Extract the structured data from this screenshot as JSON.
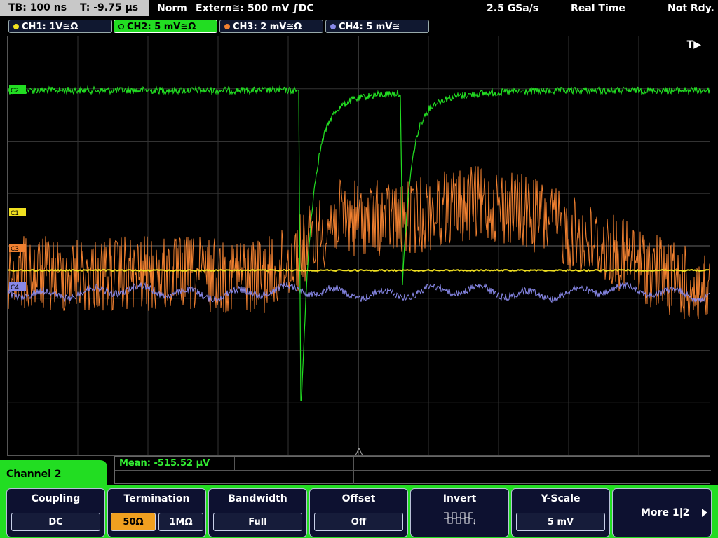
{
  "status": {
    "timebase": "TB: 100 ns",
    "trigger_time": "T: -9.75 μs",
    "mode": "Norm",
    "trigger": "Extern≅: 500 mV ∫DC",
    "sample_rate": "2.5 GSa/s",
    "acq_mode": "Real Time",
    "state": "Not Rdy."
  },
  "channels": [
    {
      "label": "CH1: 1V≅Ω",
      "color": "#f0e020"
    },
    {
      "label": "CH2: 5 mV≅Ω",
      "color": "#22dd22"
    },
    {
      "label": "CH3: 2 mV≅Ω",
      "color": "#f08030"
    },
    {
      "label": "CH4: 5 mV≅",
      "color": "#8888e8"
    }
  ],
  "markers": {
    "c2": "C2",
    "c1": "C1",
    "c3": "C3",
    "c4": "C4",
    "trigger_t": "T▶"
  },
  "measurement": {
    "mean": "Mean: -515.52 μV"
  },
  "menu": {
    "title": "Channel 2",
    "coupling": {
      "label": "Coupling",
      "value": "DC"
    },
    "termination": {
      "label": "Termination",
      "opt1": "50Ω",
      "opt2": "1MΩ"
    },
    "bandwidth": {
      "label": "Bandwidth",
      "value": "Full"
    },
    "offset": {
      "label": "Offset",
      "value": "Off"
    },
    "invert": {
      "label": "Invert",
      "icon": "invert-waveform-icon"
    },
    "yscale": {
      "label": "Y-Scale",
      "value": "5 mV"
    },
    "more": {
      "label": "More 1|2",
      "icon": "arrow-right-icon"
    }
  },
  "colors": {
    "ch1": "#f0e020",
    "ch2": "#22dd22",
    "ch3": "#f08030",
    "ch4": "#8888e8",
    "accent": "#22dd22",
    "selected": "#f0a020"
  }
}
